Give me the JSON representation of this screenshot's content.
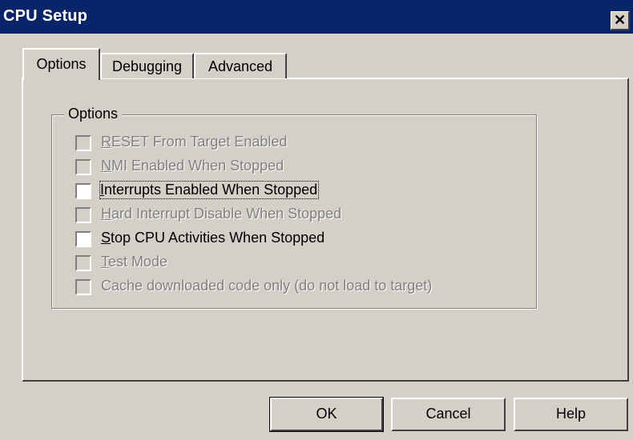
{
  "window": {
    "title": "CPU Setup",
    "close_glyph": "✕"
  },
  "tabs": [
    {
      "label": "Options",
      "active": true
    },
    {
      "label": "Debugging",
      "active": false
    },
    {
      "label": "Advanced",
      "active": false
    }
  ],
  "group": {
    "label": "Options"
  },
  "options": [
    {
      "pre": "",
      "key": "R",
      "rest": "ESET From Target Enabled",
      "checked": false,
      "enabled": false
    },
    {
      "pre": "",
      "key": "N",
      "rest": "MI Enabled When Stopped",
      "checked": false,
      "enabled": false
    },
    {
      "pre": "",
      "key": "I",
      "rest": "nterrupts Enabled When Stopped",
      "checked": false,
      "enabled": true,
      "focused": true
    },
    {
      "pre": "",
      "key": "H",
      "rest": "ard Interrupt Disable When Stopped",
      "checked": false,
      "enabled": false
    },
    {
      "pre": "",
      "key": "S",
      "rest": "top CPU Activities When Stopped",
      "checked": false,
      "enabled": true
    },
    {
      "pre": "",
      "key": "T",
      "rest": "est Mode",
      "checked": false,
      "enabled": false
    },
    {
      "pre": "",
      "key": "",
      "rest": "Cache downloaded code only (do not load to target)",
      "checked": false,
      "enabled": false
    }
  ],
  "buttons": {
    "ok": "OK",
    "cancel": "Cancel",
    "help": "Help"
  }
}
